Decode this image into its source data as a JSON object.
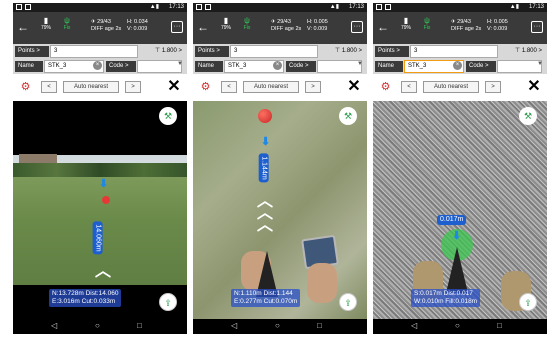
{
  "screens": [
    {
      "status": {
        "time": "17:13"
      },
      "header": {
        "battery": "79%",
        "fix_label": "Fix",
        "sat_count": "29/43",
        "diff_age": "DIFF age 2s",
        "h": "H: 0.034",
        "v": "V: 0.009"
      },
      "points_label": "Points >",
      "points_value": "3",
      "height_value": "1.800 >",
      "name_label": "Name",
      "name_value": "STK_3",
      "code_label": "Code >",
      "nav": {
        "prev": "<",
        "mode": "Auto nearest",
        "next": ">"
      },
      "distance": "14.060m",
      "info": {
        "line1": "N:13.728m Dist:14.060",
        "line2": "E:3.016m   Cut:0.033m"
      }
    },
    {
      "status": {
        "time": "17:13"
      },
      "header": {
        "battery": "79%",
        "fix_label": "Fix",
        "sat_count": "29/43",
        "diff_age": "DIFF age 2s",
        "h": "H: 0.005",
        "v": "V: 0.009"
      },
      "points_label": "Points >",
      "points_value": "3",
      "height_value": "1.800 >",
      "name_label": "Name",
      "name_value": "STK_3",
      "code_label": "Code >",
      "nav": {
        "prev": "<",
        "mode": "Auto nearest",
        "next": ">"
      },
      "distance": "1.144m",
      "info": {
        "line1": "N:1.110m Dist:1.144",
        "line2": "E:0.277m Cut:0.070m"
      }
    },
    {
      "status": {
        "time": "17:13"
      },
      "header": {
        "battery": "79%",
        "fix_label": "Fix",
        "sat_count": "29/43",
        "diff_age": "DIFF age 2s",
        "h": "H: 0.005",
        "v": "V: 0.009"
      },
      "points_label": "Points >",
      "points_value": "3",
      "height_value": "1.800 >",
      "name_label": "Name",
      "name_value": "STK_3",
      "code_label": "Code >",
      "nav": {
        "prev": "<",
        "mode": "Auto nearest",
        "next": ">"
      },
      "distance": "0.017m",
      "info": {
        "line1": "S:0.017m Dist:0.017",
        "line2": "W:0.010m Fill:0.018m"
      }
    }
  ],
  "colors": {
    "accent": "#1e5fcf",
    "fix": "#34c759",
    "gear": "#d32f2f",
    "marker": "#e53935"
  },
  "icons": {
    "back": "arrow-left-icon",
    "gear": "gear-icon",
    "close": "close-icon",
    "pole": "survey-pole-icon",
    "stakeout": "stakeout-icon"
  }
}
